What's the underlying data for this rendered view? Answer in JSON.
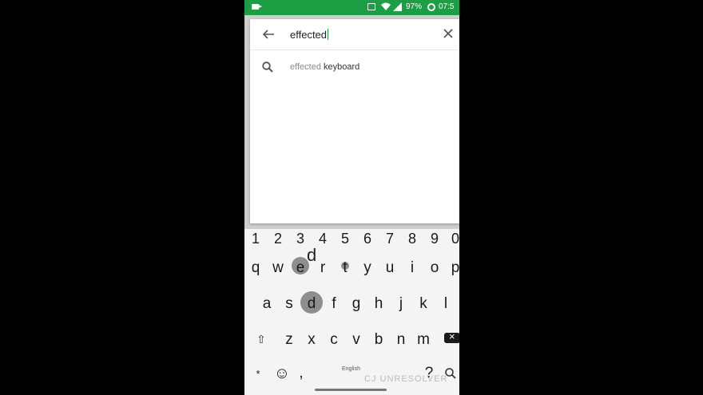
{
  "status_bar": {
    "battery": "97%",
    "time": "07:5"
  },
  "search": {
    "query": "effected"
  },
  "suggestions": [
    {
      "muted": "effected",
      "bold": "keyboard"
    }
  ],
  "keyboard": {
    "numbers": [
      "1",
      "2",
      "3",
      "4",
      "5",
      "6",
      "7",
      "8",
      "9",
      "0"
    ],
    "row1": [
      "q",
      "w",
      "e",
      "r",
      "t",
      "y",
      "u",
      "i",
      "o",
      "p"
    ],
    "row2": [
      "a",
      "s",
      "d",
      "f",
      "g",
      "h",
      "j",
      "k",
      "l"
    ],
    "row3": [
      "z",
      "x",
      "c",
      "v",
      "b",
      "n",
      "m"
    ],
    "popup_letter": "d",
    "language": "English",
    "emoji": "☺",
    "comma": ",",
    "question": "?",
    "star": "*",
    "watermark": "CJ UNRESOLVER"
  },
  "colors": {
    "status_bar": "#1e9e44",
    "pressed_key": "#8e8e8e"
  }
}
